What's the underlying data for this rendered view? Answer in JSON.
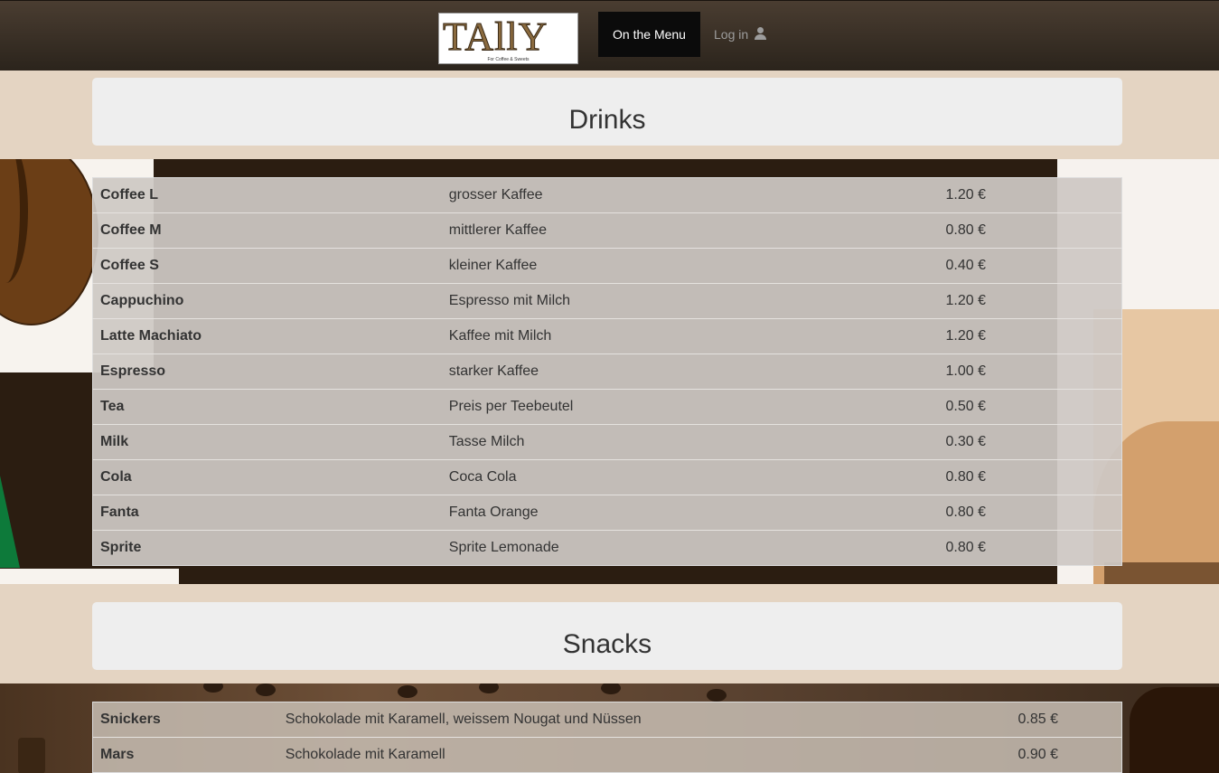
{
  "nav": {
    "brand_word": "TAllY",
    "brand_tagline": "For Coffee & Sweets",
    "active_item": "On the Menu",
    "login_label": "Log in",
    "login_icon": "user-icon"
  },
  "drinks": {
    "title": "Drinks",
    "items": [
      {
        "name": "Coffee L",
        "description": "grosser Kaffee",
        "price": "1.20 €"
      },
      {
        "name": "Coffee M",
        "description": "mittlerer Kaffee",
        "price": "0.80 €"
      },
      {
        "name": "Coffee S",
        "description": "kleiner Kaffee",
        "price": "0.40 €"
      },
      {
        "name": "Cappuchino",
        "description": "Espresso mit Milch",
        "price": "1.20 €"
      },
      {
        "name": "Latte Machiato",
        "description": "Kaffee mit Milch",
        "price": "1.20 €"
      },
      {
        "name": "Espresso",
        "description": "starker Kaffee",
        "price": "1.00 €"
      },
      {
        "name": "Tea",
        "description": "Preis per Teebeutel",
        "price": "0.50 €"
      },
      {
        "name": "Milk",
        "description": "Tasse Milch",
        "price": "0.30 €"
      },
      {
        "name": "Cola",
        "description": "Coca Cola",
        "price": "0.80 €"
      },
      {
        "name": "Fanta",
        "description": "Fanta Orange",
        "price": "0.80 €"
      },
      {
        "name": "Sprite",
        "description": "Sprite Lemonade",
        "price": "0.80 €"
      }
    ]
  },
  "snacks": {
    "title": "Snacks",
    "items": [
      {
        "name": "Snickers",
        "description": "Schokolade mit Karamell, weissem Nougat und Nüssen",
        "price": "0.85 €"
      },
      {
        "name": "Mars",
        "description": "Schokolade mit Karamell",
        "price": "0.90 €"
      }
    ]
  }
}
